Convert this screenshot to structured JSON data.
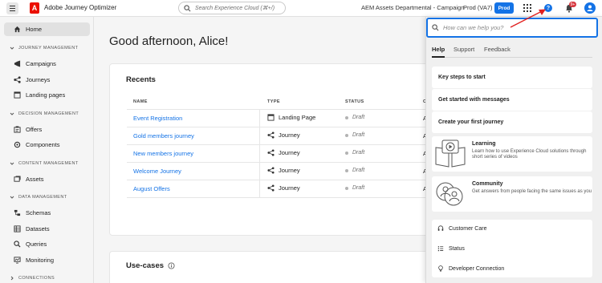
{
  "header": {
    "app_name": "Adobe Journey Optimizer",
    "search_placeholder": "Search Experience Cloud (⌘+/)",
    "org_name": "AEM Assets Departmental - Campaign",
    "sandbox": "Prod (VA7)",
    "prod_badge": "Prod",
    "notification_count": "9+"
  },
  "sidebar": {
    "home": "Home",
    "sections": [
      {
        "title": "JOURNEY MANAGEMENT",
        "items": [
          "Campaigns",
          "Journeys",
          "Landing pages"
        ]
      },
      {
        "title": "DECISION MANAGEMENT",
        "items": [
          "Offers",
          "Components"
        ]
      },
      {
        "title": "CONTENT MANAGEMENT",
        "items": [
          "Assets"
        ]
      },
      {
        "title": "DATA MANAGEMENT",
        "items": [
          "Schemas",
          "Datasets",
          "Queries",
          "Monitoring"
        ]
      },
      {
        "title": "CONNECTIONS",
        "items": []
      }
    ]
  },
  "main": {
    "greeting": "Good afternoon, Alice!",
    "recents": {
      "title": "Recents",
      "columns": [
        "NAME",
        "TYPE",
        "STATUS",
        "C"
      ],
      "rows": [
        {
          "name": "Event Registration",
          "type": "Landing Page",
          "status": "Draft",
          "extra": "A"
        },
        {
          "name": "Gold members journey",
          "type": "Journey",
          "status": "Draft",
          "extra": "A"
        },
        {
          "name": "New members journey",
          "type": "Journey",
          "status": "Draft",
          "extra": "A"
        },
        {
          "name": "Welcome Journey",
          "type": "Journey",
          "status": "Draft",
          "extra": "A"
        },
        {
          "name": "August Offers",
          "type": "Journey",
          "status": "Draft",
          "extra": "A"
        }
      ]
    },
    "usecases_title": "Use-cases"
  },
  "help_panel": {
    "search_placeholder": "How can we help you?",
    "tabs": [
      "Help",
      "Support",
      "Feedback"
    ],
    "quick_links": [
      "Key steps to start",
      "Get started with messages",
      "Create your first journey"
    ],
    "learning": {
      "title": "Learning",
      "desc": "Learn how to use Experience Cloud solutions through short series of videos"
    },
    "community": {
      "title": "Community",
      "desc": "Get answers from people facing the same issues as you"
    },
    "links": [
      "Customer Care",
      "Status",
      "Developer Connection"
    ]
  },
  "colors": {
    "accent": "#1473e6",
    "adobe_red": "#eb1000",
    "badge_red": "#d7373f",
    "arrow_red": "#e02020"
  }
}
